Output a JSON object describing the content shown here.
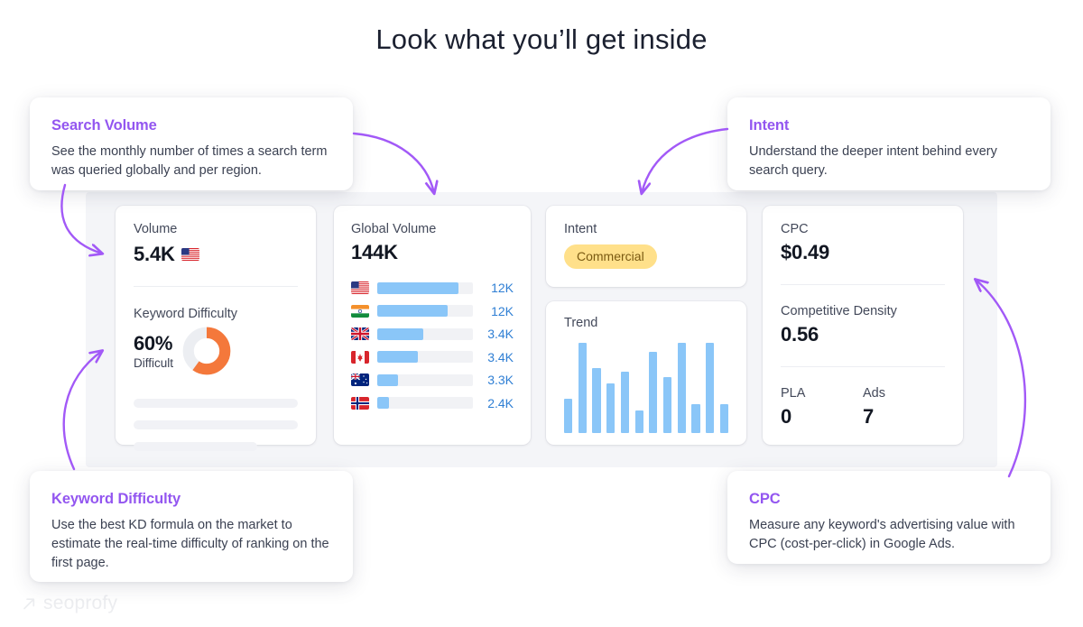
{
  "page": {
    "title": "Look what you’ll get inside",
    "watermark": "seoprofy",
    "accent_purple": "#9356f0",
    "arrow_color": "#a259f7",
    "bar_blue": "#8ac6f8",
    "value_blue": "#2f7fd4",
    "donut_orange": "#f4783b",
    "badge_bg": "#ffe08a"
  },
  "callouts": [
    {
      "id": "search-volume",
      "title": "Search Volume",
      "body": "See the monthly number of times a search term was queried globally and per region."
    },
    {
      "id": "intent",
      "title": "Intent",
      "body": "Understand the deeper intent behind every search query."
    },
    {
      "id": "keyword-difficulty",
      "title": "Keyword Difficulty",
      "body": "Use the best KD formula on the market to estimate the real-time difficulty of ranking on the first page."
    },
    {
      "id": "cpc",
      "title": "CPC",
      "body": "Measure any keyword's advertising value with CPC (cost-per-click) in Google Ads."
    }
  ],
  "dashboard": {
    "volume_card": {
      "label": "Volume",
      "value": "5.4K",
      "flag": "us-flag-icon",
      "kd_label": "Keyword Difficulty",
      "kd_percent": "60%",
      "kd_percent_number": 60,
      "kd_status": "Difficult"
    },
    "global_volume_card": {
      "label": "Global Volume",
      "value": "144K",
      "rows": [
        {
          "country": "United States",
          "flag": "us-flag-icon",
          "value": "12K",
          "fill": 85
        },
        {
          "country": "India",
          "flag": "in-flag-icon",
          "value": "12K",
          "fill": 74
        },
        {
          "country": "United Kingdom",
          "flag": "gb-flag-icon",
          "value": "3.4K",
          "fill": 48
        },
        {
          "country": "Canada",
          "flag": "ca-flag-icon",
          "value": "3.4K', ",
          "fill": 42
        },
        {
          "country": "Australia",
          "flag": "au-flag-icon",
          "value": "3.3K",
          "fill": 22
        },
        {
          "country": "Norway",
          "flag": "no-flag-icon",
          "value": "2.4K",
          "fill": 12
        }
      ]
    },
    "intent_card": {
      "label": "Intent",
      "badge": "Commercial"
    },
    "trend_card": {
      "label": "Trend"
    },
    "cpc_card": {
      "cpc_label": "CPC",
      "cpc_value": "$0.49",
      "density_label": "Competitive Density",
      "density_value": "0.56",
      "pla_label": "PLA",
      "pla_value": "0",
      "ads_label": "Ads",
      "ads_value": "7"
    }
  },
  "chart_data": [
    {
      "type": "bar",
      "title": "Global Volume",
      "orientation": "horizontal",
      "categories": [
        "United States",
        "India",
        "United Kingdom",
        "Canada",
        "Australia",
        "Norway"
      ],
      "values": [
        12000,
        12000,
        3400,
        3400,
        3300,
        2400
      ],
      "value_labels": [
        "12K",
        "12K",
        "3.4K",
        "3.4K",
        "3.3K",
        "2.4K"
      ],
      "bar_fill_percent": [
        85,
        74,
        48,
        42,
        22,
        12
      ],
      "total": "144K",
      "xlabel": "",
      "ylabel": "",
      "grid": false,
      "legend": false
    },
    {
      "type": "bar",
      "title": "Trend",
      "categories": [
        "1",
        "2",
        "3",
        "4",
        "5",
        "6",
        "7",
        "8",
        "9",
        "10",
        "11",
        "12"
      ],
      "values": [
        38,
        100,
        72,
        55,
        68,
        25,
        90,
        62,
        100,
        32,
        100,
        32
      ],
      "ylim": [
        0,
        100
      ],
      "xlabel": "",
      "ylabel": "",
      "grid": false,
      "legend": false
    },
    {
      "type": "pie",
      "title": "Keyword Difficulty",
      "labels": [
        "Difficult",
        "Remaining"
      ],
      "values": [
        60,
        40
      ],
      "value_labels": [
        "60%",
        ""
      ],
      "colors": [
        "#f4783b",
        "#eceef2"
      ],
      "donut": true
    }
  ]
}
